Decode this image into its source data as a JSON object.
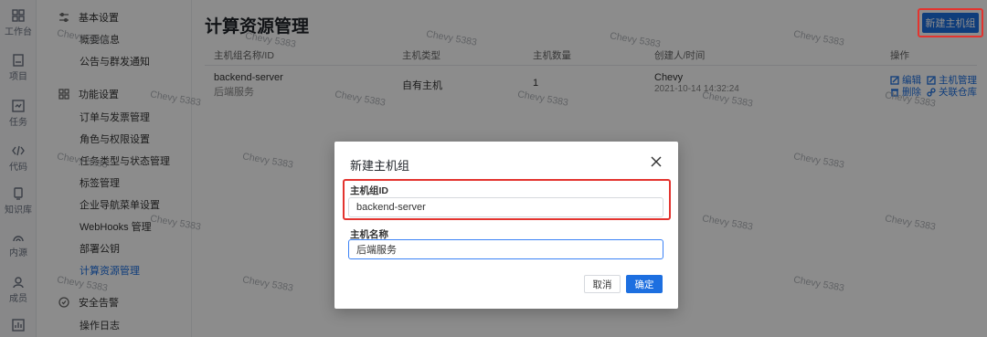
{
  "rail": [
    {
      "label": "工作台",
      "icon": "grid-icon"
    },
    {
      "label": "项目",
      "icon": "project-icon"
    },
    {
      "label": "任务",
      "icon": "task-icon"
    },
    {
      "label": "代码",
      "icon": "code-icon"
    },
    {
      "label": "知识库",
      "icon": "knowledge-icon"
    },
    {
      "label": "内源",
      "icon": "inner-source-icon"
    },
    {
      "label": "成员",
      "icon": "members-icon"
    },
    {
      "label": "",
      "icon": "chart-icon"
    }
  ],
  "sidebar": {
    "group_basic": "基本设置",
    "basic_items": [
      "概要信息",
      "公告与群发通知"
    ],
    "group_func": "功能设置",
    "func_items": [
      "订单与发票管理",
      "角色与权限设置",
      "任务类型与状态管理",
      "标签管理",
      "企业导航菜单设置",
      "WebHooks 管理",
      "部署公钥",
      "计算资源管理"
    ],
    "group_security": "安全告警",
    "security_items": [
      "操作日志"
    ]
  },
  "page": {
    "title": "计算资源管理",
    "new_button": "新建主机组"
  },
  "table": {
    "headers": [
      "主机组名称/ID",
      "主机类型",
      "主机数量",
      "创建人/时间",
      "操作"
    ],
    "row": {
      "id": "backend-server",
      "name": "后端服务",
      "type": "自有主机",
      "count": "1",
      "creator": "Chevy",
      "time": "2021-10-14 14:32:24",
      "actions": [
        "编辑",
        "主机管理",
        "删除",
        "关联仓库"
      ]
    }
  },
  "watermark": "Chevy 5383",
  "modal": {
    "title": "新建主机组",
    "id_label": "主机组ID",
    "id_value": "backend-server",
    "name_label": "主机名称",
    "name_value": "后端服务",
    "cancel": "取消",
    "confirm": "确定"
  },
  "colors": {
    "accent": "#1d6fe0",
    "highlight": "#e3342f"
  }
}
